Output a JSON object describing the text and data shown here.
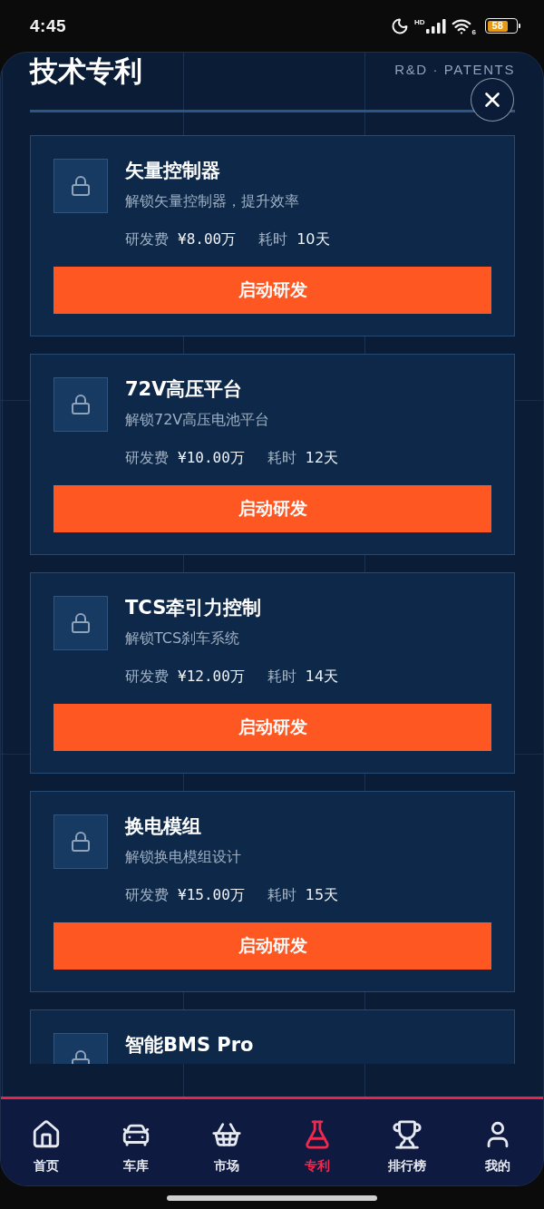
{
  "status_bar": {
    "time": "4:45",
    "network": "HD",
    "wifi": "6",
    "battery": "58"
  },
  "header": {
    "title": "技术专利",
    "subtitle": "R&D · PATENTS"
  },
  "patents": [
    {
      "name": "矢量控制器",
      "description": "解锁矢量控制器，提升效率",
      "cost_label": "研发费",
      "cost": "¥8.00万",
      "time_label": "耗时",
      "time": "10天",
      "button": "启动研发"
    },
    {
      "name": "72V高压平台",
      "description": "解锁72V高压电池平台",
      "cost_label": "研发费",
      "cost": "¥10.00万",
      "time_label": "耗时",
      "time": "12天",
      "button": "启动研发"
    },
    {
      "name": "TCS牵引力控制",
      "description": "解锁TCS刹车系统",
      "cost_label": "研发费",
      "cost": "¥12.00万",
      "time_label": "耗时",
      "time": "14天",
      "button": "启动研发"
    },
    {
      "name": "换电模组",
      "description": "解锁换电模组设计",
      "cost_label": "研发费",
      "cost": "¥15.00万",
      "time_label": "耗时",
      "time": "15天",
      "button": "启动研发"
    },
    {
      "name": "智能BMS Pro"
    }
  ],
  "nav": [
    {
      "label": "首页",
      "kind": "home",
      "selected": false
    },
    {
      "label": "车库",
      "kind": "car",
      "selected": false
    },
    {
      "label": "市场",
      "kind": "basket",
      "selected": false
    },
    {
      "label": "专利",
      "kind": "flask",
      "selected": true
    },
    {
      "label": "排行榜",
      "kind": "trophy",
      "selected": false
    },
    {
      "label": "我的",
      "kind": "user",
      "selected": false
    }
  ]
}
